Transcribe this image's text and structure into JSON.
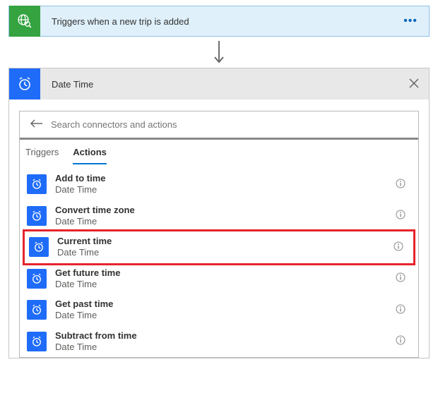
{
  "trigger": {
    "title": "Triggers when a new trip is added"
  },
  "action_header": {
    "title": "Date Time"
  },
  "search": {
    "placeholder": "Search connectors and actions"
  },
  "tabs": {
    "triggers": "Triggers",
    "actions": "Actions"
  },
  "items": [
    {
      "title": "Add to time",
      "sub": "Date Time"
    },
    {
      "title": "Convert time zone",
      "sub": "Date Time"
    },
    {
      "title": "Current time",
      "sub": "Date Time",
      "highlighted": true
    },
    {
      "title": "Get future time",
      "sub": "Date Time"
    },
    {
      "title": "Get past time",
      "sub": "Date Time"
    },
    {
      "title": "Subtract from time",
      "sub": "Date Time"
    }
  ]
}
